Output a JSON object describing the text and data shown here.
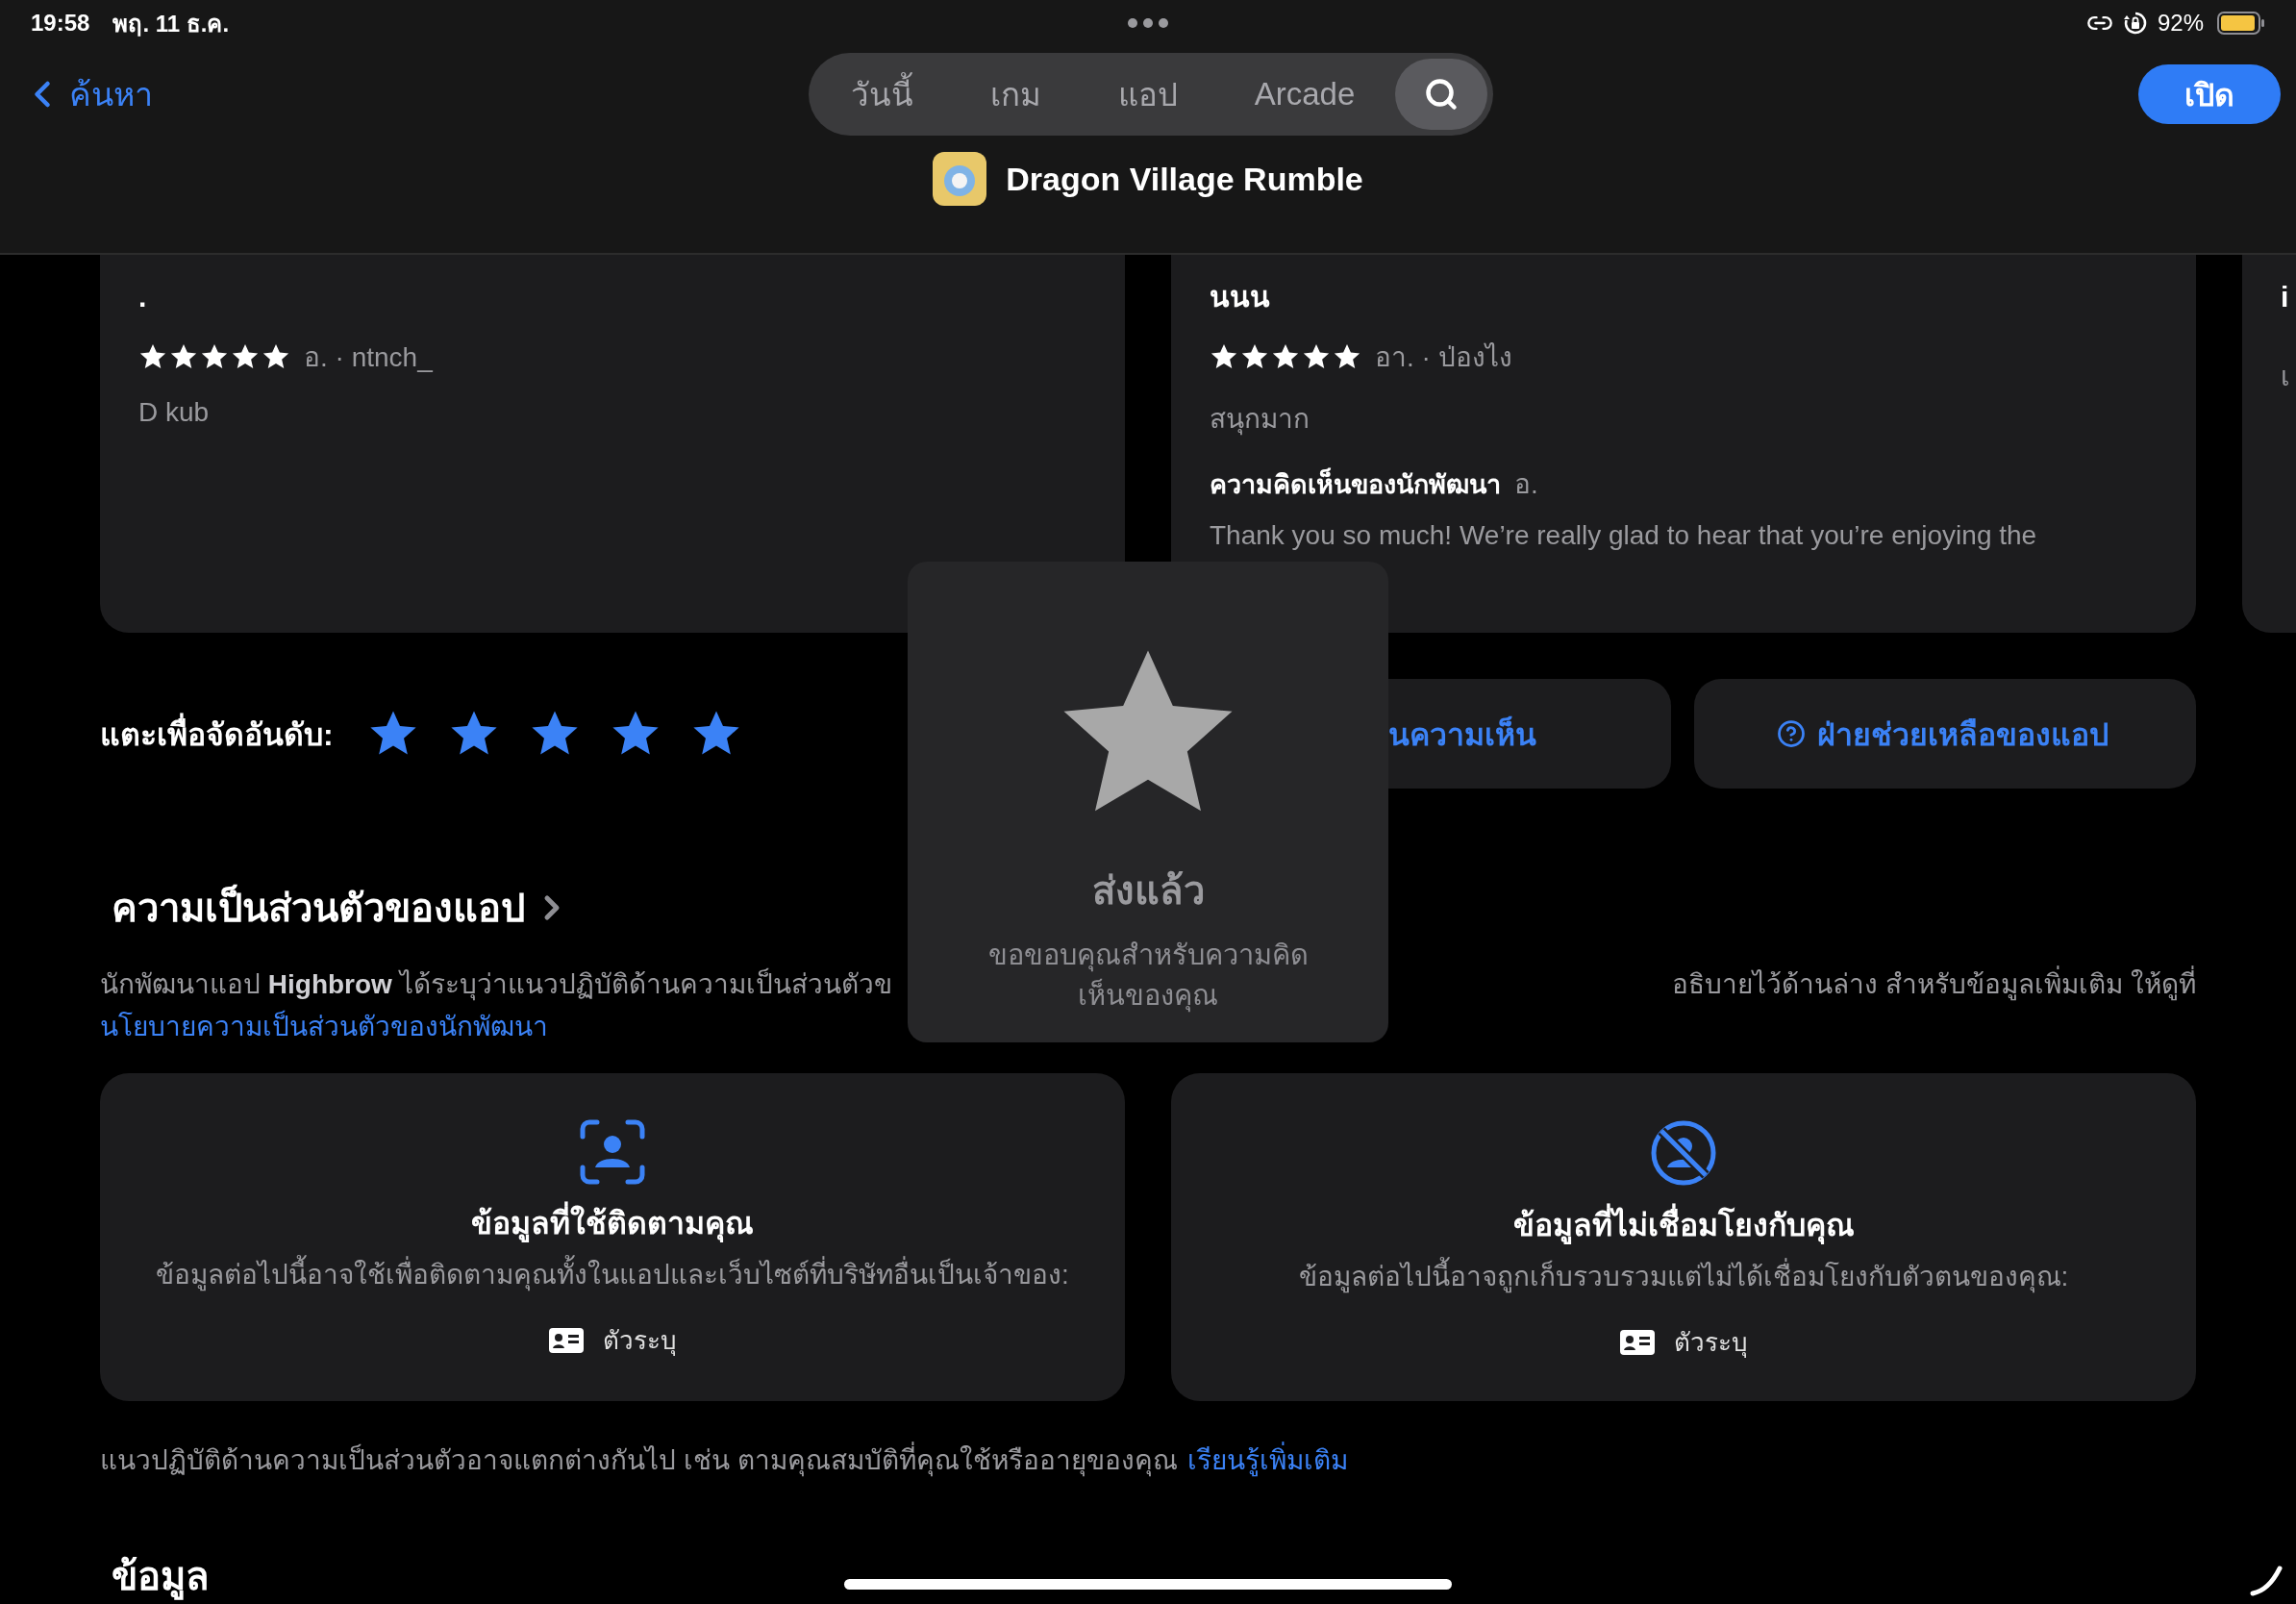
{
  "status_bar": {
    "time": "19:58",
    "date": "พฤ. 11 ธ.ค.",
    "battery_percent": "92%"
  },
  "nav": {
    "back_label": "ค้นหา",
    "tabs": [
      {
        "label": "วันนี้",
        "selected": false
      },
      {
        "label": "เกม",
        "selected": false
      },
      {
        "label": "แอป",
        "selected": false
      },
      {
        "label": "Arcade",
        "selected": false
      }
    ],
    "search_tab": {
      "selected": true
    },
    "open_button": "เปิด"
  },
  "app": {
    "title": "Dragon Village Rumble"
  },
  "reviews": [
    {
      "title": ".",
      "stars": 5,
      "meta": "อ. · ntnch_",
      "body": "D kub"
    },
    {
      "title": "นนน",
      "stars": 5,
      "meta": "อา. · ป่องไง",
      "body": "สนุกมาก",
      "developer_response": {
        "label": "ความคิดเห็นของนักพัฒนา",
        "date": "อ.",
        "text": "Thank you so much! We’re really glad to hear that you’re enjoying the"
      }
    },
    {
      "title": "i",
      "body": "เ"
    }
  ],
  "rating": {
    "label": "แตะเพื่อจัดอันดับ:",
    "stars": 5
  },
  "actions": [
    {
      "label": "นความเห็น",
      "kind": "plain"
    },
    {
      "label": "ฝ่ายช่วยเหลือของแอป",
      "kind": "help"
    }
  ],
  "privacy": {
    "heading": "ความเป็นส่วนตัวของแอป",
    "intro_left": "นักพัฒนาแอป **Highbrow** ได้ระบุว่าแนวปฏิบัติด้านความเป็นส่วนตัวข",
    "intro_right": "อธิบายไว้ด้านล่าง สำหรับข้อมูลเพิ่มเติม ให้ดูที่",
    "intro_link": "นโยบายความเป็นส่วนตัวของนักพัฒนา",
    "cards": [
      {
        "kind": "tracking",
        "title": "ข้อมูลที่ใช้ติดตามคุณ",
        "description": "ข้อมูลต่อไปนี้อาจใช้เพื่อติดตามคุณทั้งในแอปและเว็บไซต์ที่บริษัทอื่นเป็นเจ้าของ:",
        "items": [
          "ตัวระบุ"
        ]
      },
      {
        "kind": "not_linked",
        "title": "ข้อมูลที่ไม่เชื่อมโยงกับคุณ",
        "description": "ข้อมูลต่อไปนี้อาจถูกเก็บรวบรวมแต่ไม่ได้เชื่อมโยงกับตัวตนของคุณ:",
        "items": [
          "ตัวระบุ"
        ]
      }
    ],
    "footer_text": "แนวปฏิบัติด้านความเป็นส่วนตัวอาจแตกต่างกันไป เช่น ตามคุณสมบัติที่คุณใช้หรืออายุของคุณ",
    "footer_link": "เรียนรู้เพิ่มเติม"
  },
  "next_section": {
    "heading": "ข้อมูล"
  },
  "toast": {
    "title": "ส่งแล้ว",
    "message": "ขอขอบคุณสำหรับความคิดเห็นของคุณ"
  }
}
